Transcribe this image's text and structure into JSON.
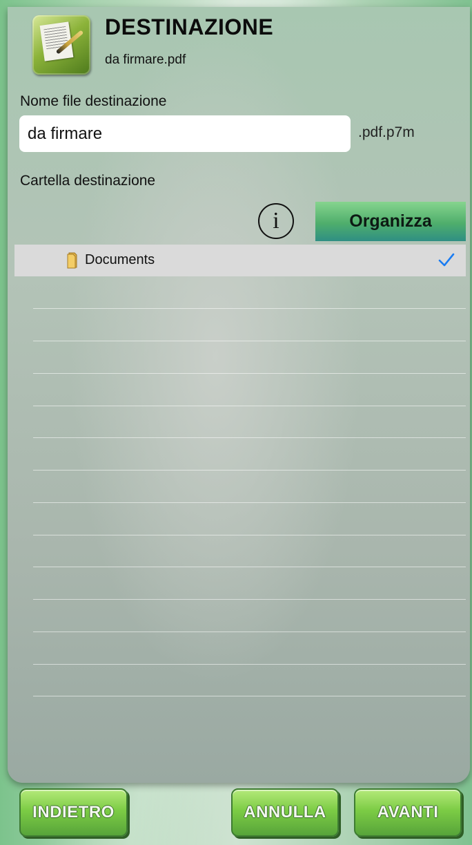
{
  "header": {
    "title": "DESTINAZIONE",
    "subtitle": "da firmare.pdf",
    "app_icon": "signature-pen-document-icon"
  },
  "form": {
    "filename_label": "Nome file destinazione",
    "filename_value": "da firmare",
    "extension": ".pdf.p7m",
    "folder_label": "Cartella destinazione"
  },
  "toolbar": {
    "info_icon": "info-circle-icon",
    "info_glyph": "i",
    "organize_label": "Organizza"
  },
  "folders": [
    {
      "name": "Documents",
      "icon": "folder-icon",
      "selected": true
    }
  ],
  "footer": {
    "back_label": "INDIETRO",
    "cancel_label": "ANNULLA",
    "next_label": "AVANTI"
  },
  "colors": {
    "button_green": "#7ccc45",
    "organize_green": "#4fae6c",
    "check_blue": "#1a7cf2",
    "selected_row": "#dadada"
  }
}
